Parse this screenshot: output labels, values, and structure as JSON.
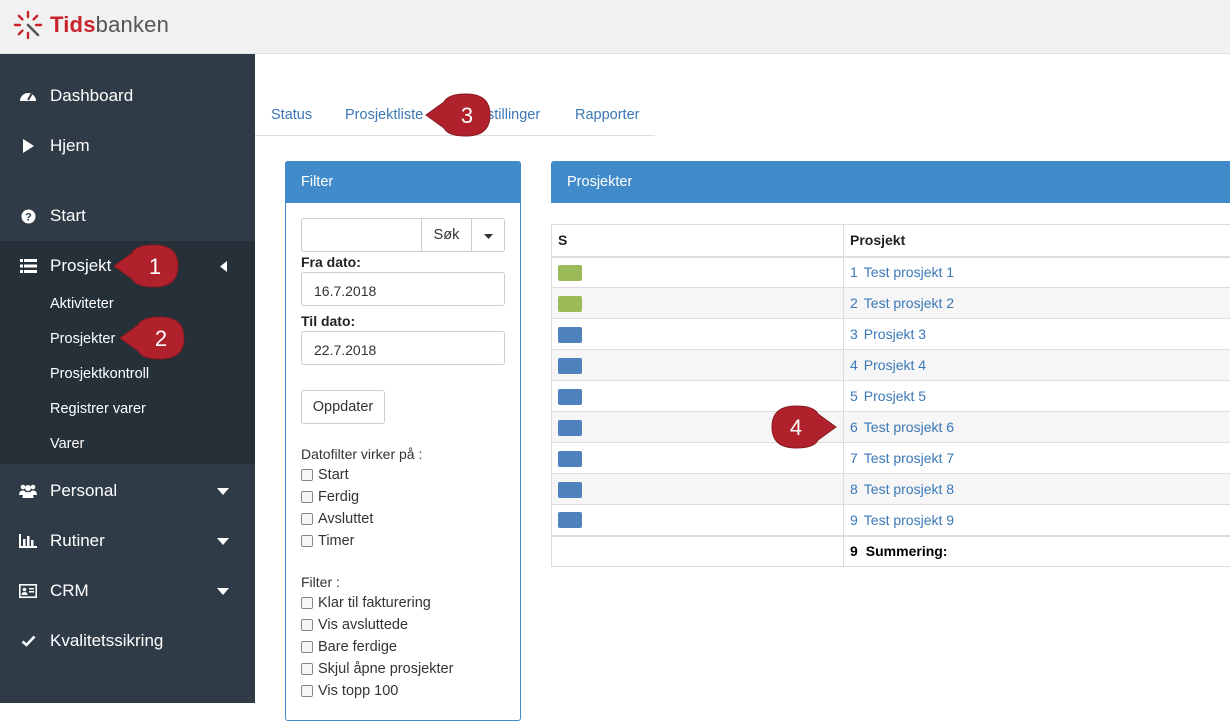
{
  "app": {
    "brand_strong": "Tids",
    "brand_rest": "banken",
    "brand_color": "#c9242b"
  },
  "sidebar": {
    "items": [
      {
        "label": "Dashboard",
        "icon": "dashboard-icon"
      },
      {
        "label": "Hjem",
        "icon": "play-icon"
      },
      {
        "label": "Start",
        "icon": "question-circle-icon"
      },
      {
        "label": "Prosjekt",
        "icon": "list-icon",
        "caret": "caret-left-icon"
      },
      {
        "label": "Personal",
        "icon": "users-icon",
        "caret": "caret-down-icon"
      },
      {
        "label": "Rutiner",
        "icon": "bar-chart-icon",
        "caret": "caret-down-icon"
      },
      {
        "label": "CRM",
        "icon": "id-card-icon",
        "caret": "caret-down-icon"
      },
      {
        "label": "Kvalitetssikring",
        "icon": "check-icon"
      }
    ],
    "submenu": [
      "Aktiviteter",
      "Prosjekter",
      "Prosjektkontroll",
      "Registrer varer",
      "Varer"
    ]
  },
  "tabs": [
    "Status",
    "Prosjektliste",
    "stillinger",
    "Rapporter"
  ],
  "filter": {
    "title": "Filter",
    "search_value": "",
    "search_button": "Søk",
    "from_label": "Fra dato:",
    "from_value": "16.7.2018",
    "to_label": "Til dato:",
    "to_value": "22.7.2018",
    "update_button": "Oppdater",
    "datefilter_label": "Datofilter virker på :",
    "datefilter_options": [
      "Start",
      "Ferdig",
      "Avsluttet",
      "Timer"
    ],
    "filter_label": "Filter :",
    "filter_options": [
      "Klar til fakturering",
      "Vis avsluttede",
      "Bare ferdige",
      "Skjul åpne prosjekter",
      "Vis topp 100"
    ]
  },
  "projects": {
    "title": "Prosjekter",
    "columns": [
      "S",
      "Prosjekt"
    ],
    "rows": [
      {
        "status_color": "#9bbb59",
        "num": "1",
        "name": "Test prosjekt 1"
      },
      {
        "status_color": "#9bbb59",
        "num": "2",
        "name": "Test prosjekt 2"
      },
      {
        "status_color": "#4f81bd",
        "num": "3",
        "name": "Prosjekt 3"
      },
      {
        "status_color": "#4f81bd",
        "num": "4",
        "name": "Prosjekt 4"
      },
      {
        "status_color": "#4f81bd",
        "num": "5",
        "name": "Prosjekt 5"
      },
      {
        "status_color": "#4f81bd",
        "num": "6",
        "name": "Test prosjekt 6"
      },
      {
        "status_color": "#4f81bd",
        "num": "7",
        "name": "Test prosjekt 7"
      },
      {
        "status_color": "#4f81bd",
        "num": "8",
        "name": "Test prosjekt 8"
      },
      {
        "status_color": "#4f81bd",
        "num": "9",
        "name": "Test prosjekt 9"
      }
    ],
    "summary": {
      "num": "9",
      "label": "Summering:"
    }
  },
  "markers": [
    "1",
    "2",
    "3",
    "4"
  ],
  "colors": {
    "sidebar": "#2f3b46",
    "panel": "#428bca",
    "link": "#3a78b8",
    "marker": "#b0212b"
  }
}
